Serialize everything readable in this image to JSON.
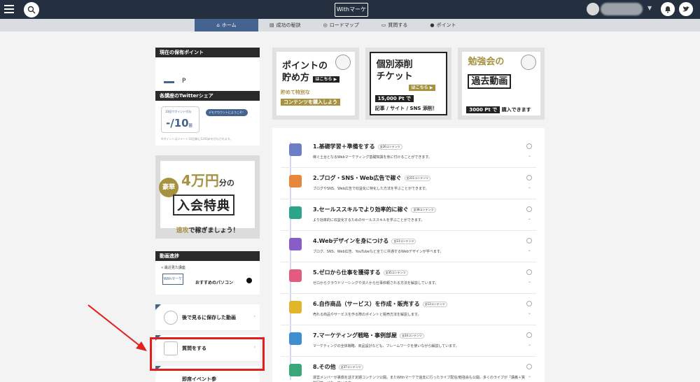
{
  "header": {
    "brand": "Withマーケ",
    "icons": [
      "menu-icon",
      "search-icon",
      "bell-icon",
      "twitter-icon"
    ]
  },
  "nav": {
    "items": [
      {
        "label": "ホーム",
        "icon": "home-icon"
      },
      {
        "label": "成功の秘訣",
        "icon": "book-icon"
      },
      {
        "label": "ロードマップ",
        "icon": "pin-icon"
      },
      {
        "label": "質問する",
        "icon": "chat-icon"
      },
      {
        "label": "ポイント",
        "icon": "coin-icon"
      }
    ]
  },
  "sidebar": {
    "points_header": "現在の保有ポイント",
    "points_unit": "P",
    "twitter_header": "各講座のTwitterシェア",
    "twitter_label": "10回でポイント付与",
    "twitter_value": "-/10",
    "twitter_value_unit": "回",
    "twitter_badge": "デモアカウントにようこそ！",
    "twitter_note": "※ポイントはツイート10回毎に1200ptを付与されます。",
    "banner_tag": "豪華",
    "banner_amount": "4万円",
    "banner_amount_suffix": "分の",
    "banner_title": "入会特典",
    "banner_sub_highlight": "速攻",
    "banner_sub_rest": "で稼ぎましょう！",
    "progress_header": "動画進捗",
    "recent_label": "最近見た講座",
    "recent_logo": "Withマーケ",
    "recent_title": "おすすめのパソコン",
    "saved_videos": "後で見るに保存した動画",
    "ask_question": "質問をする",
    "next_partial": "即席イベント参"
  },
  "promos": [
    {
      "line1": "ポイントの",
      "line2": "貯め方",
      "pill": "はこちら ▶",
      "line3": "貯めて特別な",
      "line4": "コンテンツを購入しよう"
    },
    {
      "line1": "個別添削",
      "line2": "チケット",
      "pill": "はこちら ▶",
      "line3": "15,000 Pt で",
      "line4": "記事 / サイト / SNS 添削！"
    },
    {
      "line1": "勉強会の",
      "line2": "過去動画",
      "line3": "3000 Pt で",
      "line4": "購入できます"
    }
  ],
  "courses": [
    {
      "title": "1.基礎学習＋準備をする",
      "count": "全26コンテンツ",
      "desc": "稼ぐ土台となるWebマーケティング基礎知識を身に付けることができます。",
      "color": "#6a7fc8"
    },
    {
      "title": "2.ブログ・SNS・Web広告で稼ぐ",
      "count": "全211コンテンツ",
      "desc": "ブログやSNS、Web広告で収益化に特化した方法を学ぶことができます。",
      "color": "#e8873a"
    },
    {
      "title": "3.セールススキルでより効率的に稼ぐ",
      "count": "全38コンテンツ",
      "desc": "より効率的に収益化するためのセールススキルを学ぶことができます。",
      "color": "#2aa58a"
    },
    {
      "title": "4.Webデザインを身につける",
      "count": "全13コンテンツ",
      "desc": "ブログ、SNS、Web広告、YouTubeなど全てに共通するWebデザインが学べます。",
      "color": "#8a5cc7"
    },
    {
      "title": "5.ゼロから仕事を獲得する",
      "count": "全35コンテンツ",
      "desc": "ゼロからクラウドソーシングや法人から仕事依頼される方法を解説しています。",
      "color": "#e55b80"
    },
    {
      "title": "6.自作商品（サービス）を作成・販売する",
      "count": "全13コンテンツ",
      "desc": "売れる商品やサービスを作る際のポイントと販売方法を解説します。",
      "color": "#e2b628"
    },
    {
      "title": "7.マーケティング戦略・事例部屋",
      "count": "全20コンテンツ",
      "desc": "マーケティングの全体戦略、商品設計なども、フレームワークを使いながら解説しています。",
      "color": "#3d8fcf"
    },
    {
      "title": "8.その他",
      "count": "全37コンテンツ",
      "desc": "運営メンバーが裏側を話す定期コンテンツ公開。またWithマーケで過去に行ったライブ配信/勉強会も公開。多くのライブが「講義＋質問回答」になっています。",
      "color": "#3aa77a"
    }
  ]
}
